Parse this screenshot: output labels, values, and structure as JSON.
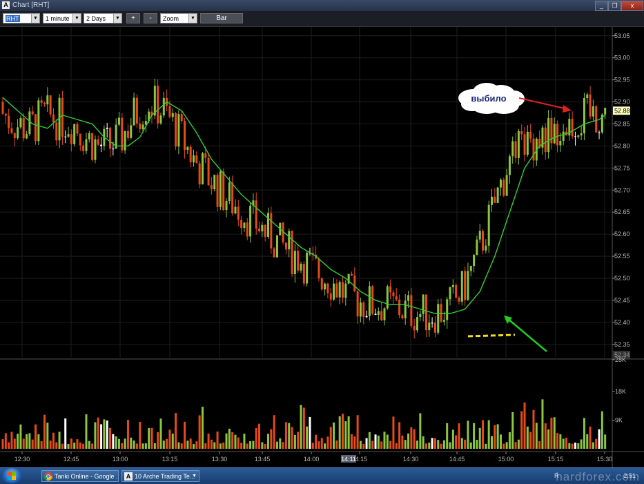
{
  "window": {
    "title": "Chart [RHT]",
    "app_icon": "A",
    "minimize_icon": "_",
    "restore_icon": "❐",
    "close_icon": "x"
  },
  "toolbar": {
    "symbol": "RHT",
    "interval": "1 minute",
    "range": "2 Days",
    "plus_label": "+",
    "minus_label": "-",
    "zoom": "Zoom",
    "bar_label": "Bar"
  },
  "chart_data": {
    "type": "bar",
    "symbol": "RHT",
    "price_axis": {
      "ticks": [
        "53.05",
        "53.00",
        "52.95",
        "52.90",
        "52.85",
        "52.80",
        "52.75",
        "52.70",
        "52.65",
        "52.60",
        "52.55",
        "52.50",
        "52.45",
        "52.40",
        "52.35"
      ],
      "ylim": [
        52.32,
        53.07
      ],
      "current_price": "52.88",
      "low_marker": "52.34"
    },
    "volume_axis": {
      "ticks": [
        "28K",
        "18K",
        "9K"
      ],
      "ylim": [
        0,
        28000
      ]
    },
    "time_axis": {
      "ticks": [
        "12:30",
        "12:45",
        "13:00",
        "13:15",
        "13:30",
        "13:45",
        "14:00",
        "14:15",
        "14:30",
        "14:45",
        "15:00",
        "15:15",
        "15:30"
      ],
      "cursor_label": "14:11"
    },
    "ma_x": [
      0,
      5,
      10,
      15,
      20,
      25,
      30,
      34,
      38,
      42,
      46,
      50,
      55,
      60,
      65,
      70,
      75,
      80,
      85,
      90,
      95,
      100,
      105,
      110,
      115,
      120,
      125,
      130,
      135,
      140,
      145,
      150,
      155,
      160,
      165,
      170,
      175,
      180,
      185,
      190,
      195,
      200,
      202
    ],
    "ma_y": [
      52.91,
      52.88,
      52.85,
      52.84,
      52.87,
      52.86,
      52.85,
      52.82,
      52.8,
      52.8,
      52.82,
      52.87,
      52.9,
      52.88,
      52.83,
      52.77,
      52.73,
      52.69,
      52.66,
      52.63,
      52.6,
      52.57,
      52.55,
      52.52,
      52.5,
      52.47,
      52.45,
      52.44,
      52.44,
      52.43,
      52.42,
      52.42,
      52.43,
      52.47,
      52.55,
      52.65,
      52.75,
      52.8,
      52.82,
      52.83,
      52.85,
      52.86,
      52.87
    ],
    "annotations": {
      "callout": "выбило",
      "callout_color": "#ffffff",
      "arrow_up_color": "#e32020",
      "arrow_low_color": "#20d020",
      "support_line_color": "#f0e020"
    },
    "colors": {
      "up": "#8cc63f",
      "down": "#e64a19",
      "neutral": "#ffffff",
      "ma": "#30d030",
      "grid": "#1e1e1e",
      "background": "#000000"
    }
  },
  "taskbar": {
    "items": [
      {
        "label": "Tanki Online - Google ..."
      },
      {
        "label": "10 Arche Trading Te..."
      }
    ],
    "tray_text": "R",
    "clock": "2:51",
    "watermark": "hardforex.com"
  }
}
